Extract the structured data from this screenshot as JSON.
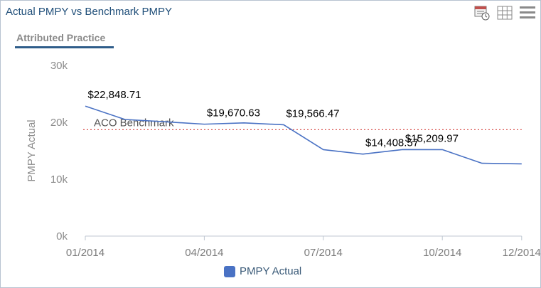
{
  "header": {
    "title": "Actual PMPY vs Benchmark PMPY",
    "tab_label": "Attributed Practice",
    "toolbar": [
      {
        "name": "calendar-export-icon"
      },
      {
        "name": "grid-table-icon"
      },
      {
        "name": "menu-icon"
      }
    ]
  },
  "chart_data": {
    "type": "line",
    "ylabel": "PMPY Actual",
    "ylim": [
      0,
      30000
    ],
    "y_ticks": [
      {
        "value": 0,
        "label": "0k"
      },
      {
        "value": 10000,
        "label": "10k"
      },
      {
        "value": 20000,
        "label": "20k"
      },
      {
        "value": 30000,
        "label": "30k"
      }
    ],
    "x_ticks": [
      {
        "index": 0,
        "label": "01/2014"
      },
      {
        "index": 3,
        "label": "04/2014"
      },
      {
        "index": 6,
        "label": "07/2014"
      },
      {
        "index": 9,
        "label": "10/2014"
      },
      {
        "index": 11,
        "label": "12/2014"
      }
    ],
    "x": [
      "01/2014",
      "02/2014",
      "03/2014",
      "04/2014",
      "05/2014",
      "06/2014",
      "07/2014",
      "08/2014",
      "09/2014",
      "10/2014",
      "11/2014",
      "12/2014"
    ],
    "series": [
      {
        "name": "PMPY Actual",
        "color": "#4a72c4",
        "values": [
          22848.71,
          20500,
          20100,
          19670.63,
          19900,
          19566.47,
          15200,
          14408.57,
          15209.97,
          15200,
          12800,
          12700
        ],
        "labels": [
          {
            "index": 0,
            "text": "$22,848.71"
          },
          {
            "index": 3,
            "text": "$19,670.63"
          },
          {
            "index": 5,
            "text": "$19,566.47"
          },
          {
            "index": 7,
            "text": "$14,408.57"
          },
          {
            "index": 8,
            "text": "$15,209.97"
          }
        ]
      }
    ],
    "reference_lines": [
      {
        "label": "ACO Benchmark",
        "value": 18700,
        "color": "#d9534f",
        "style": "dotted"
      }
    ],
    "legend": {
      "position": "bottom",
      "entries": [
        "PMPY Actual"
      ]
    },
    "grid": false
  }
}
